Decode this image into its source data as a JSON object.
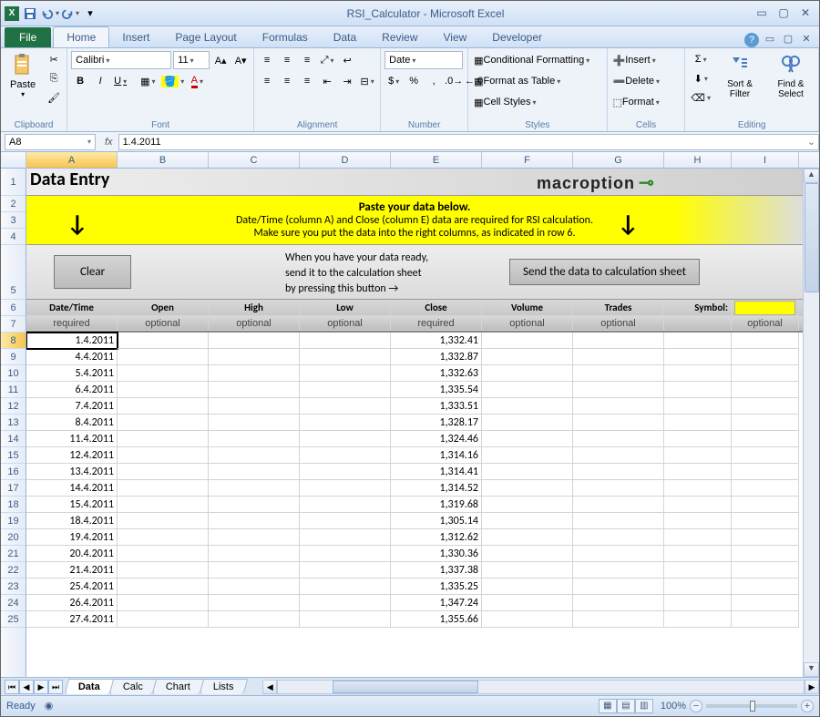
{
  "window": {
    "title": "RSI_Calculator - Microsoft Excel",
    "app_icon": "X"
  },
  "qat": {
    "save": "save-icon",
    "undo": "undo-icon",
    "redo": "redo-icon"
  },
  "tabs": {
    "file": "File",
    "home": "Home",
    "insert": "Insert",
    "pagelayout": "Page Layout",
    "formulas": "Formulas",
    "data": "Data",
    "review": "Review",
    "view": "View",
    "developer": "Developer"
  },
  "ribbon": {
    "clipboard": {
      "label": "Clipboard",
      "paste": "Paste"
    },
    "font": {
      "label": "Font",
      "name": "Calibri",
      "size": "11",
      "bold": "B",
      "italic": "I",
      "underline": "U"
    },
    "alignment": {
      "label": "Alignment"
    },
    "number": {
      "label": "Number",
      "format": "Date",
      "currency": "$",
      "percent": "%",
      "comma": ","
    },
    "styles": {
      "label": "Styles",
      "cond": "Conditional Formatting",
      "table": "Format as Table",
      "cell": "Cell Styles"
    },
    "cells": {
      "label": "Cells",
      "insert": "Insert",
      "delete": "Delete",
      "format": "Format"
    },
    "editing": {
      "label": "Editing",
      "sort": "Sort & Filter",
      "find": "Find & Select"
    }
  },
  "namebox": "A8",
  "formula": "1.4.2011",
  "columns": [
    "A",
    "B",
    "C",
    "D",
    "E",
    "F",
    "G",
    "H",
    "I"
  ],
  "row_labels": [
    "1",
    "2",
    "3",
    "4",
    "5",
    "6",
    "7",
    "8",
    "9",
    "10",
    "11",
    "12",
    "13",
    "14",
    "15",
    "16",
    "17",
    "18",
    "19",
    "20",
    "21",
    "22",
    "23",
    "24",
    "25"
  ],
  "sheet": {
    "title": "Data Entry",
    "logo": "macroption",
    "banner": {
      "header": "Paste your data below.",
      "line1": "Date/Time (column A) and Close (column E) data are required for RSI calculation.",
      "line2": "Make sure you put the data into the right columns, as indicated in row 6."
    },
    "buttons": {
      "clear": "Clear",
      "send": "Send the data to calculation sheet",
      "midtext1": "When you have your data ready,",
      "midtext2": "send it to the calculation sheet",
      "midtext3": "by pressing this button    →"
    },
    "headers": {
      "A": "Date/Time",
      "B": "Open",
      "C": "High",
      "D": "Low",
      "E": "Close",
      "F": "Volume",
      "G": "Trades",
      "H": "Symbol:"
    },
    "req": {
      "A": "required",
      "B": "optional",
      "C": "optional",
      "D": "optional",
      "E": "required",
      "F": "optional",
      "G": "optional",
      "I": "optional"
    },
    "data": [
      {
        "r": 8,
        "date": "1.4.2011",
        "close": "1,332.41"
      },
      {
        "r": 9,
        "date": "4.4.2011",
        "close": "1,332.87"
      },
      {
        "r": 10,
        "date": "5.4.2011",
        "close": "1,332.63"
      },
      {
        "r": 11,
        "date": "6.4.2011",
        "close": "1,335.54"
      },
      {
        "r": 12,
        "date": "7.4.2011",
        "close": "1,333.51"
      },
      {
        "r": 13,
        "date": "8.4.2011",
        "close": "1,328.17"
      },
      {
        "r": 14,
        "date": "11.4.2011",
        "close": "1,324.46"
      },
      {
        "r": 15,
        "date": "12.4.2011",
        "close": "1,314.16"
      },
      {
        "r": 16,
        "date": "13.4.2011",
        "close": "1,314.41"
      },
      {
        "r": 17,
        "date": "14.4.2011",
        "close": "1,314.52"
      },
      {
        "r": 18,
        "date": "15.4.2011",
        "close": "1,319.68"
      },
      {
        "r": 19,
        "date": "18.4.2011",
        "close": "1,305.14"
      },
      {
        "r": 20,
        "date": "19.4.2011",
        "close": "1,312.62"
      },
      {
        "r": 21,
        "date": "20.4.2011",
        "close": "1,330.36"
      },
      {
        "r": 22,
        "date": "21.4.2011",
        "close": "1,337.38"
      },
      {
        "r": 23,
        "date": "25.4.2011",
        "close": "1,335.25"
      },
      {
        "r": 24,
        "date": "26.4.2011",
        "close": "1,347.24"
      },
      {
        "r": 25,
        "date": "27.4.2011",
        "close": "1,355.66"
      }
    ]
  },
  "sheet_tabs": [
    "Data",
    "Calc",
    "Chart",
    "Lists"
  ],
  "status": {
    "ready": "Ready",
    "zoom": "100%"
  }
}
